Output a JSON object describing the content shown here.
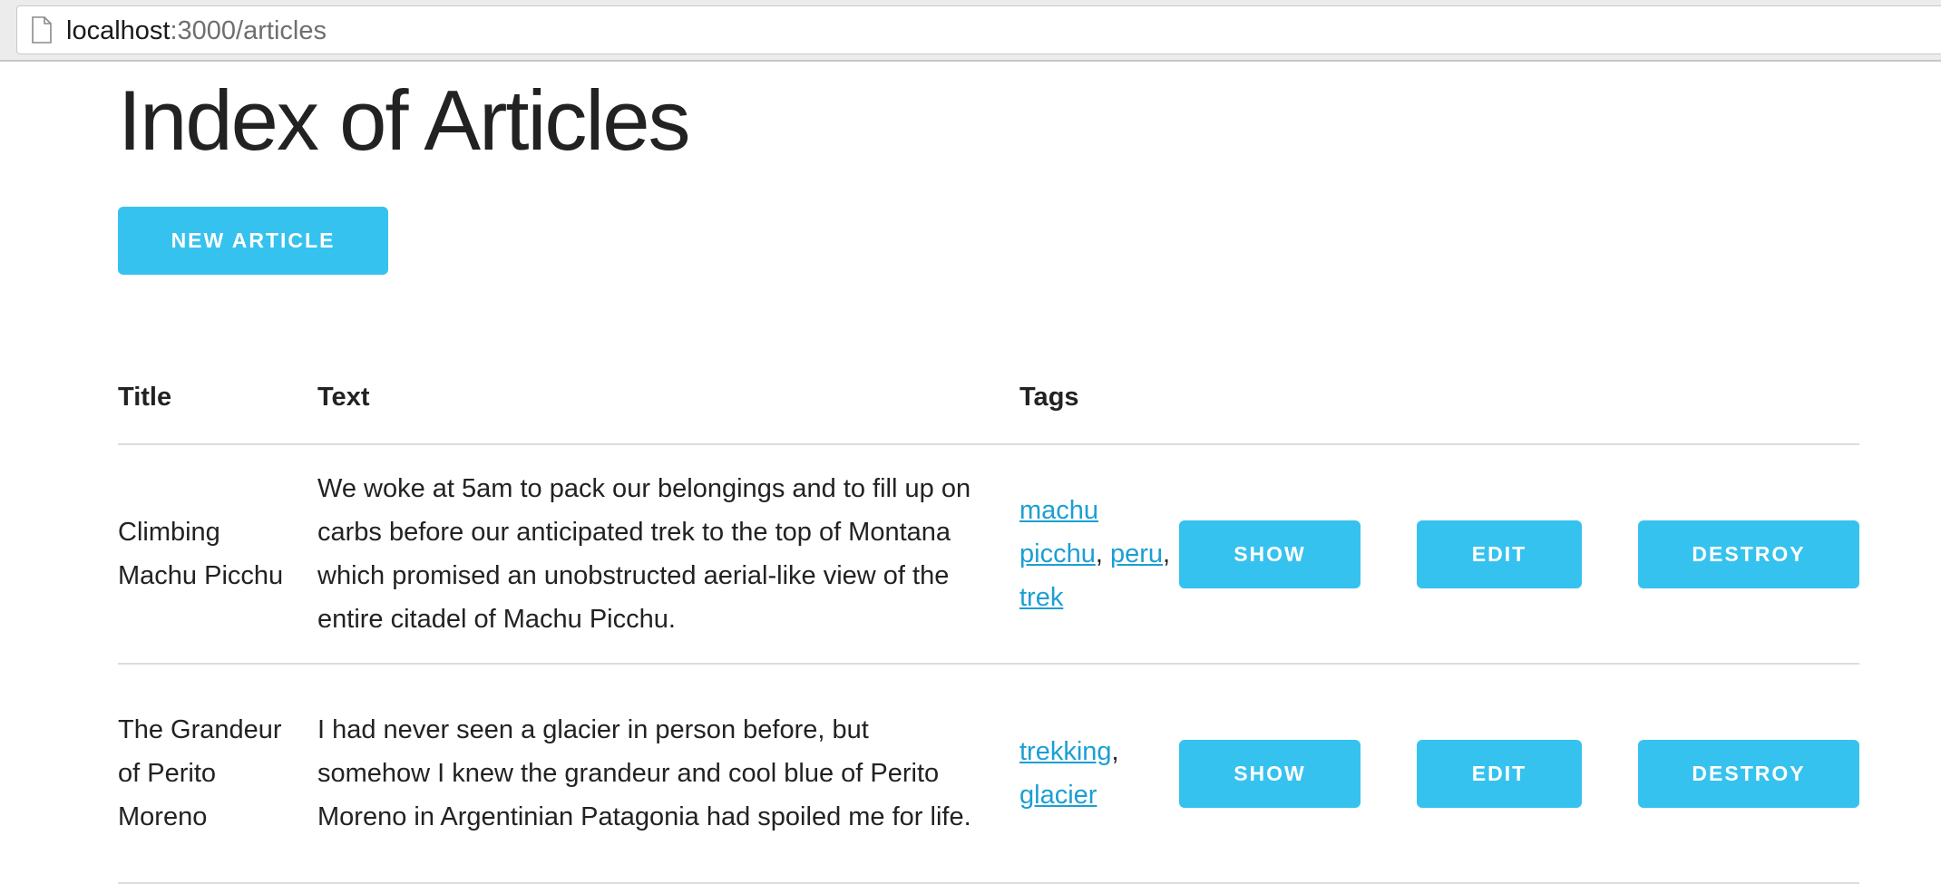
{
  "browser": {
    "url_host": "localhost",
    "url_rest": ":3000/articles"
  },
  "page": {
    "title": "Index of Articles",
    "new_article_label": "NEW ARTICLE"
  },
  "table": {
    "headers": [
      "Title",
      "Text",
      "Tags"
    ],
    "rows": [
      {
        "title": "Climbing Machu Picchu",
        "text": "We woke at 5am to pack our belongings and to fill up on carbs before our anticipated trek to the top of Montana which promised an unobstructed aerial-like view of the entire citadel of Machu Picchu.",
        "tags": [
          "machu picchu",
          "peru",
          "trek"
        ],
        "show_label": "SHOW",
        "edit_label": "EDIT",
        "destroy_label": "DESTROY"
      },
      {
        "title": "The Grandeur of Perito Moreno",
        "text": "I had never seen a glacier in person before, but somehow I knew the grandeur and cool blue of Perito Moreno in Argentinian Patagonia had spoiled me for life.",
        "tags": [
          "trekking",
          "glacier"
        ],
        "show_label": "SHOW",
        "edit_label": "EDIT",
        "destroy_label": "DESTROY"
      }
    ]
  },
  "colors": {
    "button": "#36c2ee",
    "link": "#1b9fd3"
  }
}
